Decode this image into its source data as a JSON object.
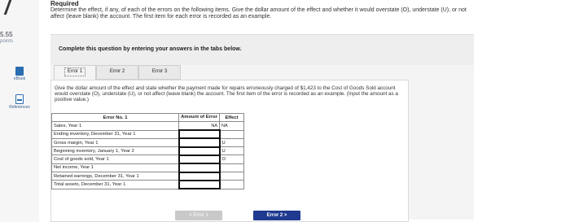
{
  "sidebar": {
    "score": "5.55",
    "score_unit": "points",
    "items": [
      {
        "label": "eBook",
        "icon": "book-icon"
      },
      {
        "label": "References",
        "icon": "document-icon"
      }
    ]
  },
  "header": {
    "title": "Required",
    "instructions": "Determine the effect, if any, of each of the errors on the following items. Give the dollar amount of the effect and whether it would overstate (O), understate (U), or not affect (leave blank) the account. The first item for each error is recorded as an example."
  },
  "panel": {
    "text": "Complete this question by entering your answers in the tabs below."
  },
  "tabs": [
    {
      "label": "Error 1",
      "active": true
    },
    {
      "label": "Error 2",
      "active": false
    },
    {
      "label": "Error 3",
      "active": false
    }
  ],
  "question": {
    "text": "Give the dollar amount of the effect and state whether the payment made for repairs erroneously charged of $1,423 to the Cost of Goods Sold account would overstate (O), understate (U), or not affect (leave blank) the account. The first item of the error is recorded as an example. (Input the amount as a positive value.)"
  },
  "table": {
    "header_desc": "Error No. 1",
    "header_amount": "Amount of Error",
    "header_effect": "Effect",
    "rows": [
      {
        "label": "Sales, Year 1",
        "amount": "NA",
        "effect": "NA"
      },
      {
        "label": "Ending inventory, December 31, Year 1",
        "amount": "",
        "effect": ""
      },
      {
        "label": "Gross margin, Year 1",
        "amount": "",
        "effect": "U"
      },
      {
        "label": "Beginning inventory, January 1, Year 2",
        "amount": "",
        "effect": "U"
      },
      {
        "label": "Cost of goods sold, Year 1",
        "amount": "",
        "effect": "O"
      },
      {
        "label": "Net income, Year 1",
        "amount": "",
        "effect": ""
      },
      {
        "label": "Retained earnings, December 31, Year 1",
        "amount": "",
        "effect": ""
      },
      {
        "label": "Total assets, December 31, Year 1",
        "amount": "",
        "effect": ""
      }
    ]
  },
  "navigation": {
    "prev_label": "< Error 1",
    "next_label": "Error 2 >"
  },
  "colors": {
    "accent": "#1f3a8f",
    "link": "#2b6cb0"
  }
}
